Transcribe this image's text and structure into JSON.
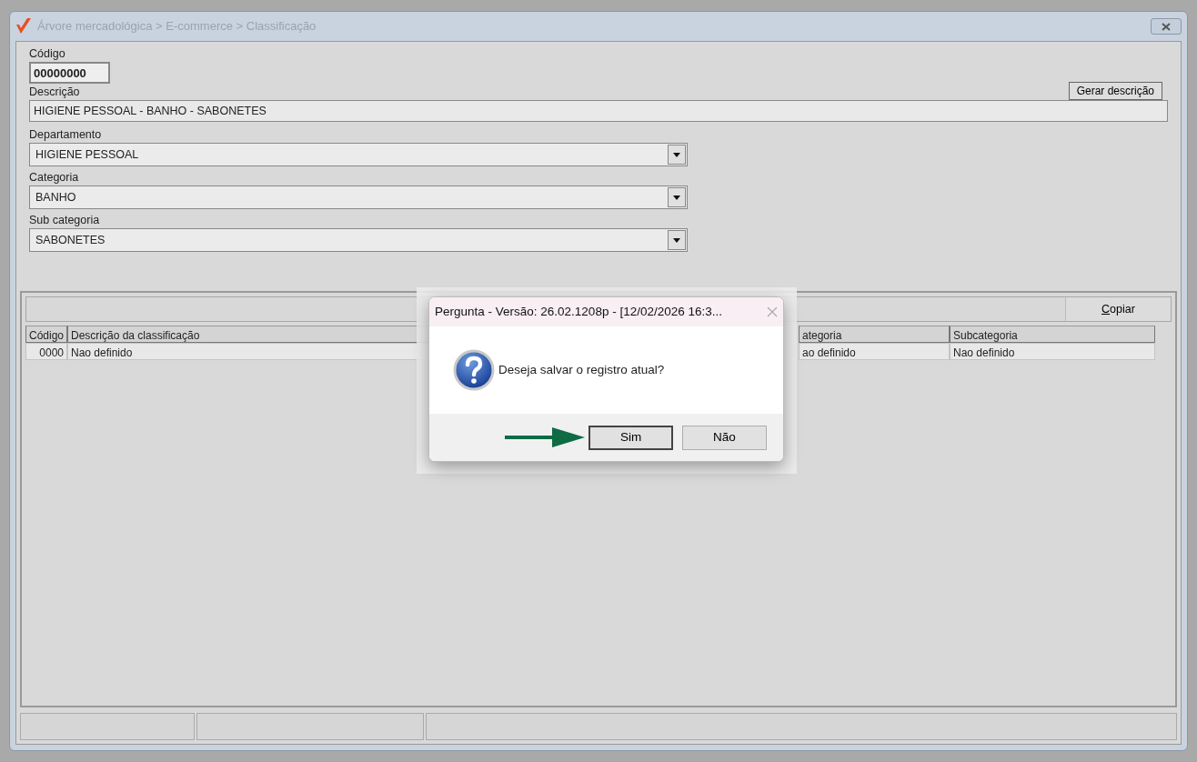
{
  "window": {
    "title": "Árvore mercadológica > E-commerce > Classificação"
  },
  "form": {
    "code": {
      "label": "Código",
      "value": "00000000"
    },
    "description": {
      "label": "Descrição",
      "value": "HIGIENE PESSOAL - BANHO - SABONETES"
    },
    "generate_button": "Gerar descrição",
    "selects": [
      {
        "label": "Departamento",
        "value": "HIGIENE PESSOAL"
      },
      {
        "label": "Categoria",
        "value": "BANHO"
      },
      {
        "label": "Sub categoria",
        "value": "SABONETES"
      }
    ]
  },
  "toolbar": {
    "copy_button": "Copiar"
  },
  "table": {
    "columns": [
      "Código",
      "Descrição da classificação",
      "ategoria",
      "Subcategoria"
    ],
    "rows": [
      [
        "0000",
        "Nao definido",
        "ao definido",
        "Nao definido"
      ]
    ]
  },
  "dialog": {
    "title": "Pergunta - Versão: 26.02.1208p - [12/02/2026 16:3...",
    "message": "Deseja salvar o registro atual?",
    "buttons": [
      {
        "label": "Sim",
        "focused": true
      },
      {
        "label": "Não",
        "focused": false
      }
    ]
  }
}
